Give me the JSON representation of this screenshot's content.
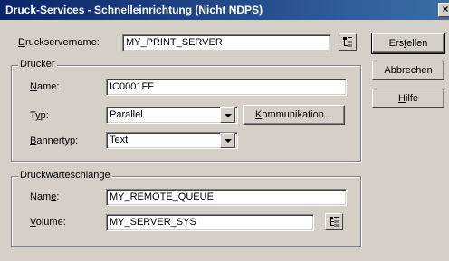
{
  "window": {
    "title": "Druck-Services - Schnelleinrichtung (Nicht NDPS)",
    "close_glyph": "×"
  },
  "server": {
    "label_pre": "",
    "label_access": "D",
    "label_post": "ruckservername:",
    "value": "MY_PRINT_SERVER",
    "browse_icon": "tree-browse-icon"
  },
  "printer_group": {
    "title": "Drucker",
    "name_label_access": "N",
    "name_label_post": "ame:",
    "name_value": "IC0001FF",
    "type_label_pre": "T",
    "type_label_access": "y",
    "type_label_post": "p:",
    "type_value": "Parallel",
    "communication_access": "K",
    "communication_post": "ommunikation...",
    "banner_label_access": "B",
    "banner_label_post": "annertyp:",
    "banner_value": "Text"
  },
  "queue_group": {
    "title": "Druckwarteschlange",
    "name_label_pre": "Nam",
    "name_label_access": "e",
    "name_label_post": ":",
    "name_value": "MY_REMOTE_QUEUE",
    "volume_label_access": "V",
    "volume_label_post": "olume:",
    "volume_value": "MY_SERVER_SYS",
    "browse_icon": "tree-browse-icon"
  },
  "buttons": {
    "create_pre": "Ers",
    "create_access": "t",
    "create_post": "ellen",
    "cancel": "Abbrechen",
    "help_access": "H",
    "help_post": "ilfe"
  }
}
